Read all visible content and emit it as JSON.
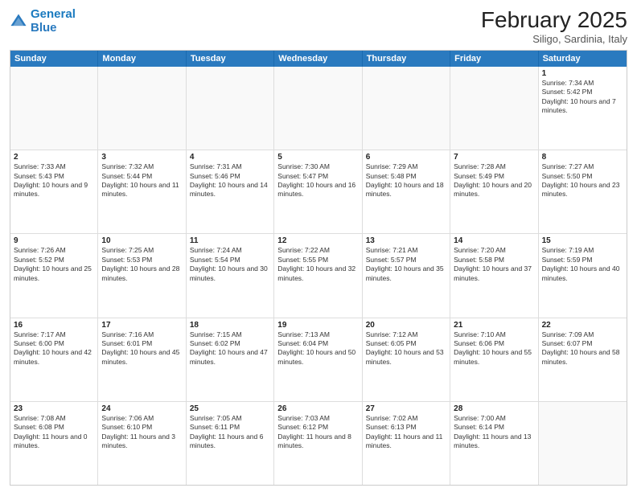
{
  "header": {
    "logo": {
      "line1": "General",
      "line2": "Blue"
    },
    "month": "February 2025",
    "location": "Siligo, Sardinia, Italy"
  },
  "weekdays": [
    "Sunday",
    "Monday",
    "Tuesday",
    "Wednesday",
    "Thursday",
    "Friday",
    "Saturday"
  ],
  "rows": [
    [
      {
        "day": "",
        "info": ""
      },
      {
        "day": "",
        "info": ""
      },
      {
        "day": "",
        "info": ""
      },
      {
        "day": "",
        "info": ""
      },
      {
        "day": "",
        "info": ""
      },
      {
        "day": "",
        "info": ""
      },
      {
        "day": "1",
        "info": "Sunrise: 7:34 AM\nSunset: 5:42 PM\nDaylight: 10 hours and 7 minutes."
      }
    ],
    [
      {
        "day": "2",
        "info": "Sunrise: 7:33 AM\nSunset: 5:43 PM\nDaylight: 10 hours and 9 minutes."
      },
      {
        "day": "3",
        "info": "Sunrise: 7:32 AM\nSunset: 5:44 PM\nDaylight: 10 hours and 11 minutes."
      },
      {
        "day": "4",
        "info": "Sunrise: 7:31 AM\nSunset: 5:46 PM\nDaylight: 10 hours and 14 minutes."
      },
      {
        "day": "5",
        "info": "Sunrise: 7:30 AM\nSunset: 5:47 PM\nDaylight: 10 hours and 16 minutes."
      },
      {
        "day": "6",
        "info": "Sunrise: 7:29 AM\nSunset: 5:48 PM\nDaylight: 10 hours and 18 minutes."
      },
      {
        "day": "7",
        "info": "Sunrise: 7:28 AM\nSunset: 5:49 PM\nDaylight: 10 hours and 20 minutes."
      },
      {
        "day": "8",
        "info": "Sunrise: 7:27 AM\nSunset: 5:50 PM\nDaylight: 10 hours and 23 minutes."
      }
    ],
    [
      {
        "day": "9",
        "info": "Sunrise: 7:26 AM\nSunset: 5:52 PM\nDaylight: 10 hours and 25 minutes."
      },
      {
        "day": "10",
        "info": "Sunrise: 7:25 AM\nSunset: 5:53 PM\nDaylight: 10 hours and 28 minutes."
      },
      {
        "day": "11",
        "info": "Sunrise: 7:24 AM\nSunset: 5:54 PM\nDaylight: 10 hours and 30 minutes."
      },
      {
        "day": "12",
        "info": "Sunrise: 7:22 AM\nSunset: 5:55 PM\nDaylight: 10 hours and 32 minutes."
      },
      {
        "day": "13",
        "info": "Sunrise: 7:21 AM\nSunset: 5:57 PM\nDaylight: 10 hours and 35 minutes."
      },
      {
        "day": "14",
        "info": "Sunrise: 7:20 AM\nSunset: 5:58 PM\nDaylight: 10 hours and 37 minutes."
      },
      {
        "day": "15",
        "info": "Sunrise: 7:19 AM\nSunset: 5:59 PM\nDaylight: 10 hours and 40 minutes."
      }
    ],
    [
      {
        "day": "16",
        "info": "Sunrise: 7:17 AM\nSunset: 6:00 PM\nDaylight: 10 hours and 42 minutes."
      },
      {
        "day": "17",
        "info": "Sunrise: 7:16 AM\nSunset: 6:01 PM\nDaylight: 10 hours and 45 minutes."
      },
      {
        "day": "18",
        "info": "Sunrise: 7:15 AM\nSunset: 6:02 PM\nDaylight: 10 hours and 47 minutes."
      },
      {
        "day": "19",
        "info": "Sunrise: 7:13 AM\nSunset: 6:04 PM\nDaylight: 10 hours and 50 minutes."
      },
      {
        "day": "20",
        "info": "Sunrise: 7:12 AM\nSunset: 6:05 PM\nDaylight: 10 hours and 53 minutes."
      },
      {
        "day": "21",
        "info": "Sunrise: 7:10 AM\nSunset: 6:06 PM\nDaylight: 10 hours and 55 minutes."
      },
      {
        "day": "22",
        "info": "Sunrise: 7:09 AM\nSunset: 6:07 PM\nDaylight: 10 hours and 58 minutes."
      }
    ],
    [
      {
        "day": "23",
        "info": "Sunrise: 7:08 AM\nSunset: 6:08 PM\nDaylight: 11 hours and 0 minutes."
      },
      {
        "day": "24",
        "info": "Sunrise: 7:06 AM\nSunset: 6:10 PM\nDaylight: 11 hours and 3 minutes."
      },
      {
        "day": "25",
        "info": "Sunrise: 7:05 AM\nSunset: 6:11 PM\nDaylight: 11 hours and 6 minutes."
      },
      {
        "day": "26",
        "info": "Sunrise: 7:03 AM\nSunset: 6:12 PM\nDaylight: 11 hours and 8 minutes."
      },
      {
        "day": "27",
        "info": "Sunrise: 7:02 AM\nSunset: 6:13 PM\nDaylight: 11 hours and 11 minutes."
      },
      {
        "day": "28",
        "info": "Sunrise: 7:00 AM\nSunset: 6:14 PM\nDaylight: 11 hours and 13 minutes."
      },
      {
        "day": "",
        "info": ""
      }
    ]
  ]
}
